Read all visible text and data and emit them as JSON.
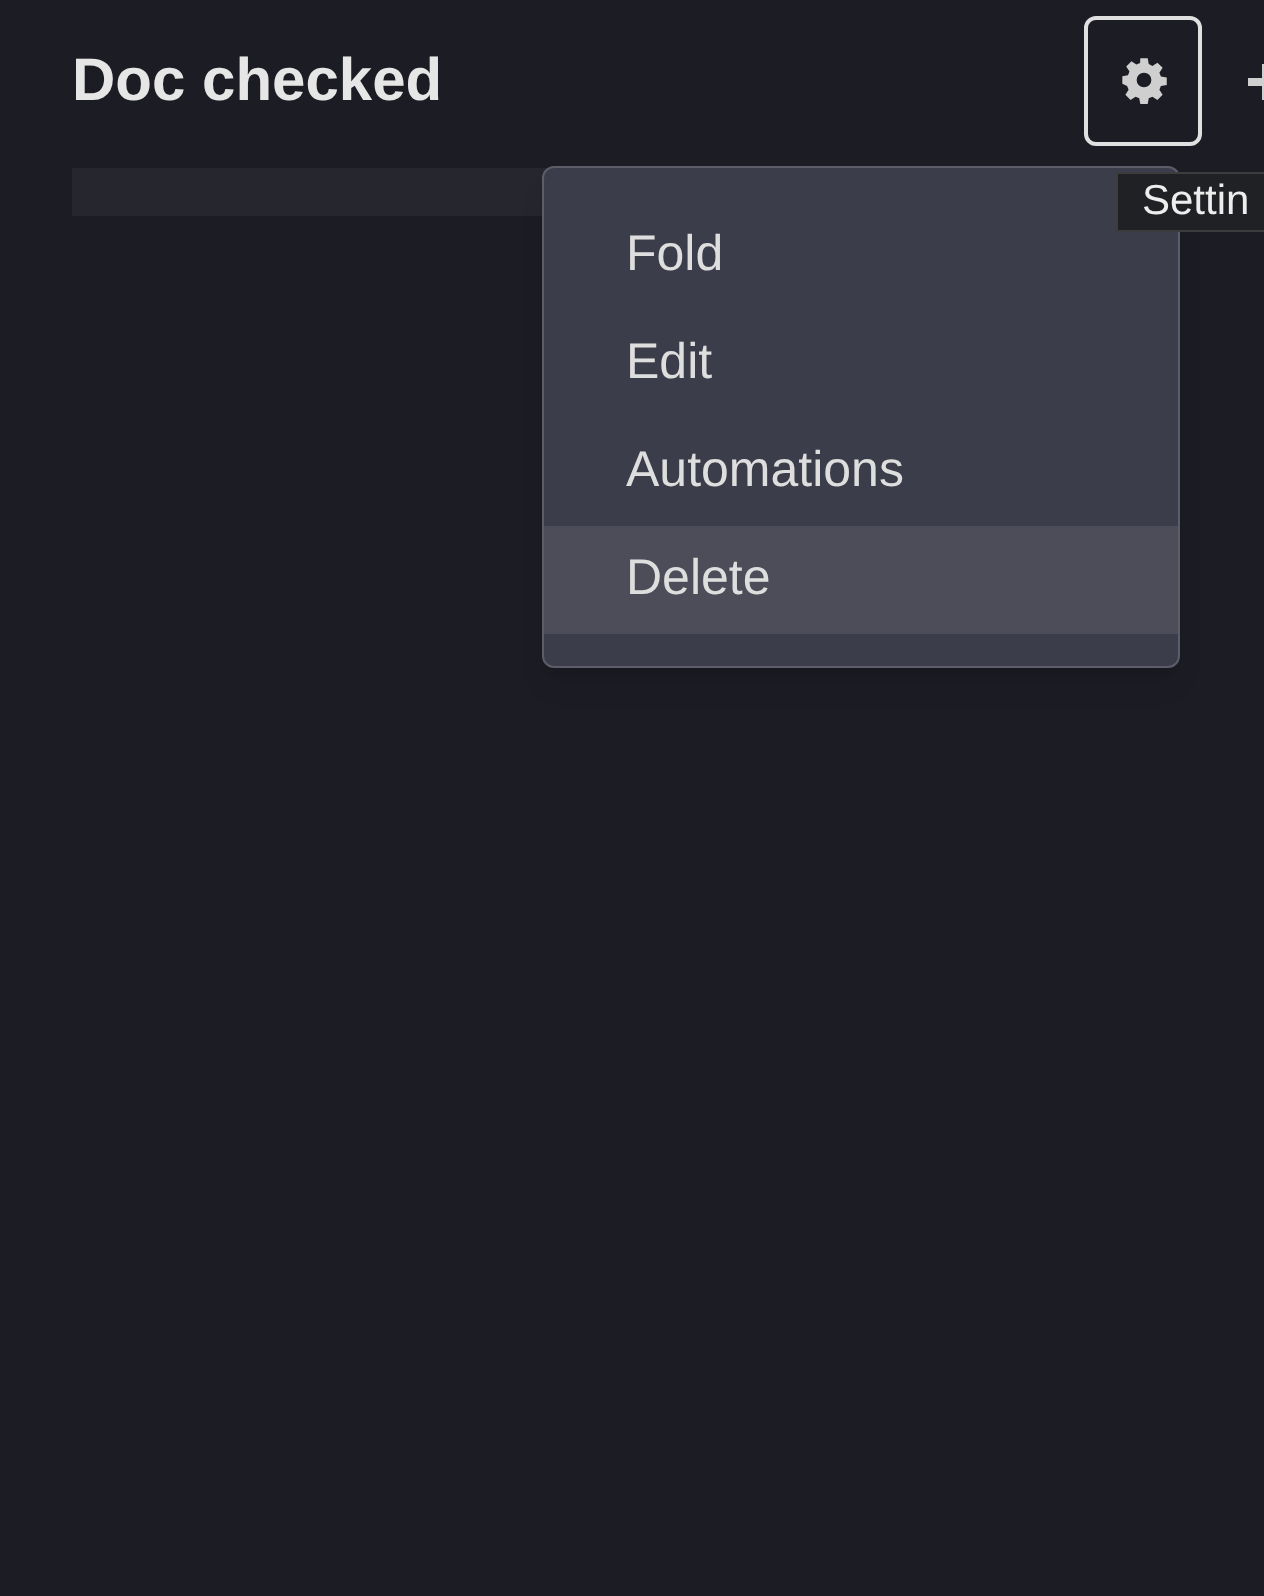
{
  "header": {
    "title": "Doc checked"
  },
  "menu": {
    "items": [
      {
        "label": "Fold",
        "selected": false
      },
      {
        "label": "Edit",
        "selected": false
      },
      {
        "label": "Automations",
        "selected": false
      },
      {
        "label": "Delete",
        "selected": true
      }
    ]
  },
  "tooltip": {
    "text": "Settin"
  }
}
